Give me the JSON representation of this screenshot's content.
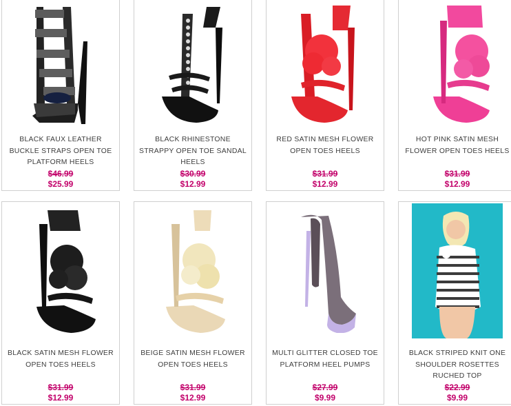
{
  "products": [
    {
      "name": "BLACK FAUX LEATHER BUCKLE STRAPS OPEN TOE PLATFORM HEELS",
      "old_price": "$46.99",
      "price": "$25.99",
      "image": "black-buckle-platform-heel"
    },
    {
      "name": "BLACK RHINESTONE STRAPPY OPEN TOE SANDAL HEELS",
      "old_price": "$30.99",
      "price": "$12.99",
      "image": "black-rhinestone-sandal"
    },
    {
      "name": "RED SATIN MESH FLOWER OPEN TOES HEELS",
      "old_price": "$31.99",
      "price": "$12.99",
      "image": "red-flower-heel"
    },
    {
      "name": "HOT PINK SATIN MESH FLOWER OPEN TOES HEELS",
      "old_price": "$31.99",
      "price": "$12.99",
      "image": "pink-flower-heel"
    },
    {
      "name": "BLACK SATIN MESH FLOWER OPEN TOES HEELS",
      "old_price": "$31.99",
      "price": "$12.99",
      "image": "black-flower-heel"
    },
    {
      "name": "BEIGE SATIN MESH FLOWER OPEN TOES HEELS",
      "old_price": "$31.99",
      "price": "$12.99",
      "image": "beige-flower-heel"
    },
    {
      "name": "MULTI GLITTER CLOSED TOE PLATFORM HEEL PUMPS",
      "old_price": "$27.99",
      "price": "$9.99",
      "image": "glitter-pump"
    },
    {
      "name": "BLACK STRIPED KNIT ONE SHOULDER ROSETTES RUCHED TOP",
      "old_price": "$22.99",
      "price": "$9.99",
      "image": "striped-top-model"
    }
  ],
  "colors": {
    "price": "#c2006a",
    "border": "#cfcfcf",
    "text": "#3c3c3c"
  }
}
